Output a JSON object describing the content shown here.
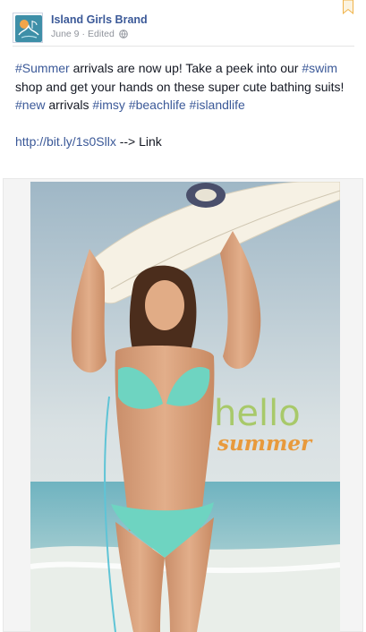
{
  "post": {
    "author": "Island Girls Brand",
    "date": "June 9",
    "separator": "·",
    "edited": "Edited",
    "message": {
      "line1_parts": [
        {
          "type": "hashtag",
          "text": "#Summer"
        },
        {
          "type": "text",
          "text": " arrivals are now up! Take a peek into our "
        },
        {
          "type": "hashtag",
          "text": "#swim"
        },
        {
          "type": "text",
          "text": " shop and get your hands on these super cute bathing suits! "
        },
        {
          "type": "hashtag",
          "text": "#new"
        },
        {
          "type": "text",
          "text": " arrivals "
        },
        {
          "type": "hashtag",
          "text": "#imsy"
        },
        {
          "type": "text",
          "text": " "
        },
        {
          "type": "hashtag",
          "text": "#beachlife"
        },
        {
          "type": "text",
          "text": " "
        },
        {
          "type": "hashtag",
          "text": "#islandlife"
        }
      ],
      "link_url": "http://bit.ly/1s0Sllx",
      "link_suffix": " --> Link"
    },
    "photo": {
      "overlay_line1": "hello",
      "overlay_line2": "summer"
    }
  },
  "colors": {
    "link": "#3b5998",
    "overlay_hello": "#a8c96a",
    "overlay_summer": "#e89a3c",
    "bookmark": "#f0b34a"
  },
  "icons": {
    "avatar": "island-girls-logo",
    "globe": "globe-icon",
    "bookmark": "bookmark-icon"
  }
}
